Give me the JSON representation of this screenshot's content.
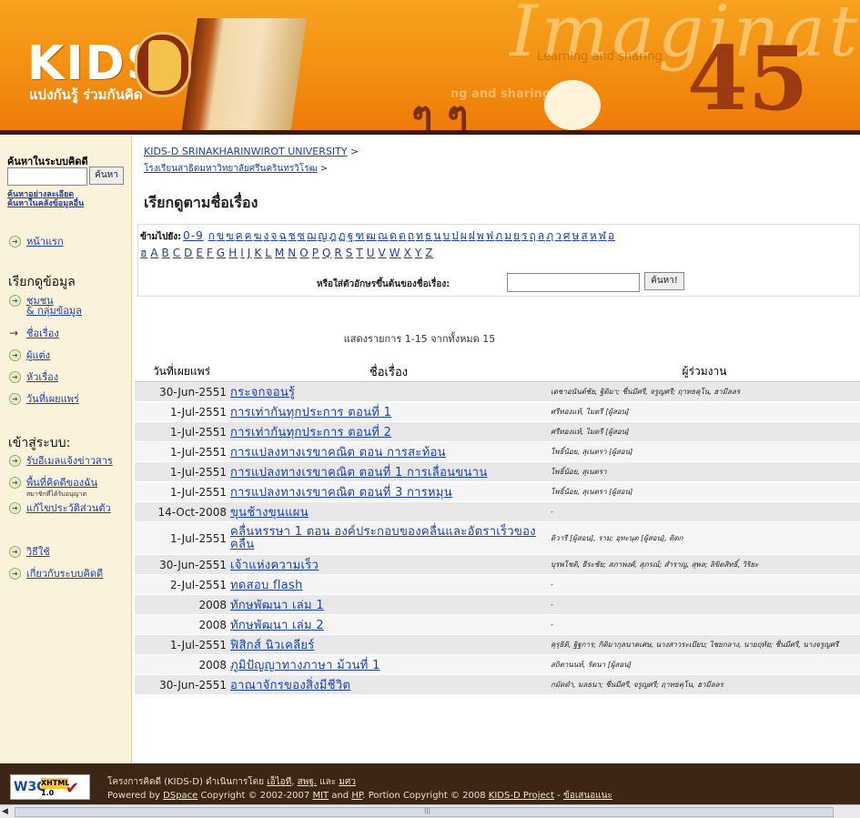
{
  "header": {
    "logo_text": "KIDS",
    "tagline": "แบ่งกันรู้ ร่วมกันคิด",
    "bg_text": "Imagination",
    "bg_sub": "Learning and sharing",
    "bg_sub2": "ng and sharing",
    "logo_d": "D",
    "deco_number": "45"
  },
  "sidebar": {
    "search_title": "ค้นหาในระบบคิดดี",
    "search_button": "ค้นหา",
    "advanced_search": "ค้นหาอย่างละเอียด",
    "search_all": "ค้นหาในคลังข้อมูลอื่น",
    "home": "หน้าแรก",
    "browse_header": "เรียกดูข้อมูล",
    "browse_items": [
      "ชุมชน",
      "& กลุ่มข้อมูล",
      "ชื่อเรื่อง",
      "ผู้แต่ง",
      "หัวเรื่อง",
      "วันที่เผยแพร่"
    ],
    "signon_header": "เข้าสู่ระบบ:",
    "signon_items": [
      "รับอีเมลแจ้งข่าวสาร",
      "พื้นที่คิดดีของฉัน",
      "แก้ไขประวัติส่วนตัว"
    ],
    "signon_note": "สมาชิกที่ได้รับอนุญาต",
    "help": "วิธีใช้",
    "about": "เกี่ยวกับระบบคิดดี"
  },
  "breadcrumb": {
    "level1": "KIDS-D SRINAKHARINWIROT UNIVERSITY",
    "level2": "โรงเรียนสาธิตมหาวิทยาลัยศรีนครินทรวิโรฒ",
    "separator": ">"
  },
  "page_title": "เรียกดูตามชื่อเรื่อง",
  "jump": {
    "label": "ข้ามไปยัง:",
    "digits": "0-9",
    "thai_letters": [
      "ก",
      "ข",
      "ฃ",
      "ค",
      "ฅ",
      "ฆ",
      "ง",
      "จ",
      "ฉ",
      "ช",
      "ซ",
      "ฌ",
      "ญ",
      "ฎ",
      "ฏ",
      "ฐ",
      "ฑ",
      "ฒ",
      "ณ",
      "ด",
      "ต",
      "ถ",
      "ท",
      "ธ",
      "น",
      "บ",
      "ป",
      "ผ",
      "ฝ",
      "พ",
      "ฟ",
      "ภ",
      "ม",
      "ย",
      "ร",
      "ฤ",
      "ล",
      "ฦ",
      "ว",
      "ศ",
      "ษ",
      "ส",
      "ห",
      "ฬ",
      "อ"
    ],
    "row2": [
      "ฮ",
      "A",
      "B",
      "C",
      "D",
      "E",
      "F",
      "G",
      "H",
      "I",
      "J",
      "K",
      "L",
      "M",
      "N",
      "O",
      "P",
      "Q",
      "R",
      "S",
      "T",
      "U",
      "V",
      "W",
      "X",
      "Y",
      "Z"
    ],
    "starts_label": "หรือใส่ตัวอักษรขึ้นต้นของชื่อเรื่อง:",
    "starts_value": "",
    "starts_button": "ค้นหา!"
  },
  "result_info": "แสดงรายการ 1-15 จากทั้งหมด 15",
  "table": {
    "headers": [
      "วันที่เผยแพร่",
      "ชื่อเรื่อง",
      "ผู้ร่วมงาน"
    ],
    "rows": [
      {
        "date": "30-Jun-2551",
        "title": "กระจกจอนรู้",
        "authors": "เดชาอนันต์ชัย, ฐิติมา; ชื่นมีศรี, จรูญศรี; ฤาทธคุโน, ฮามีลลร"
      },
      {
        "date": "1-Jul-2551",
        "title": "การเท่ากันทุกประการ ตอนที่ 1",
        "authors": "ศรีทองแท้, ไมตรี [ผู้สอน]"
      },
      {
        "date": "1-Jul-2551",
        "title": "การเท่ากันทุกประการ ตอนที่ 2",
        "authors": "ศรีทองแท้, ไมตรี [ผู้สอน]"
      },
      {
        "date": "1-Jul-2551",
        "title": "การแปลงทางเรขาคณิต ตอน การสะท้อน",
        "authors": "โพธิ์น้อย, สุเนตรา [ผู้สอน]"
      },
      {
        "date": "1-Jul-2551",
        "title": "การแปลงทางเรขาคณิต ตอนที่ 1 การเลื่อนขนาน",
        "authors": "โพธิ์น้อย, สุเนตรา"
      },
      {
        "date": "1-Jul-2551",
        "title": "การแปลงทางเรขาคณิต ตอนที่ 3 การหมุน",
        "authors": "โพธิ์น้อย, สุเนตรา [ผู้สอน]"
      },
      {
        "date": "14-Oct-2008",
        "title": "ขุนช้างขุนแผน",
        "authors": "-"
      },
      {
        "date": "1-Jul-2551",
        "title": "คลื่นหรรษา 1 ตอน องค์ประกอบของคลื่นและอัตราเร็วของคลื่น",
        "authors": "ดิวารี [ผู้สอน], ราม; อุทะนุด [ผู้สอน], ดิดก"
      },
      {
        "date": "30-Jun-2551",
        "title": "เจ้าแห่งความเร็ว",
        "authors": "บุรพโชติ, ธีระชัย; สภาพงศ์, สุภรณ์; สำราญ, สุพล; ลิขิตสิทธิ์, วิริยะ"
      },
      {
        "date": "2-Jul-2551",
        "title": "ทดสอบ flash",
        "authors": "-"
      },
      {
        "date": "2008",
        "title": "ทักษพัฒนา เล่ม 1",
        "authors": "-"
      },
      {
        "date": "2008",
        "title": "ทักษพัฒนา เล่ม 2",
        "authors": "-"
      },
      {
        "date": "1-Jul-2551",
        "title": "ฟิสิกส์ นิวเคลียร์",
        "authors": "คุรุธิติ, ฐิฐการ; กิติมากุลนาคเศษ, นางสาวระเบียบ; ไชยกลาง, นายฤทัย; ชื่นมีศรี, นางจรูญศรี"
      },
      {
        "date": "2008",
        "title": "ภูมิปัญญาทางภาษา ม้วนที่ 1",
        "authors": "สถิตานนท์, รัตนา [ผู้สอน]"
      },
      {
        "date": "30-Jun-2551",
        "title": "อาณาจักรของสิ่งมีชีวิต",
        "authors": "กมัดดำ, มลธนา; ชื่นมีศรี, จรูญศรี; ฤาทธคุโน, ฮามีลลร"
      }
    ]
  },
  "footer": {
    "w3c": "W3C",
    "xhtml": "XHTML",
    "xhtml_ver": "1.0",
    "line1_prefix": "โครงการคิดดี (KIDS-D) ดำเนินการโดย",
    "line1_links": [
      "เอ็ไอที",
      "สพฐ.",
      "มศว"
    ],
    "line1_and": "และ",
    "line2_prefix": "Powered by",
    "dspace": "DSpace",
    "line2_mid": "Copyright © 2002-2007",
    "mit": "MIT",
    "and": "and",
    "hp": "HP",
    "line2_mid2": "Portion Copyright © 2008",
    "kidsd": "KIDS-D Project",
    "feedback": "ข้อเสนอแนะ"
  }
}
